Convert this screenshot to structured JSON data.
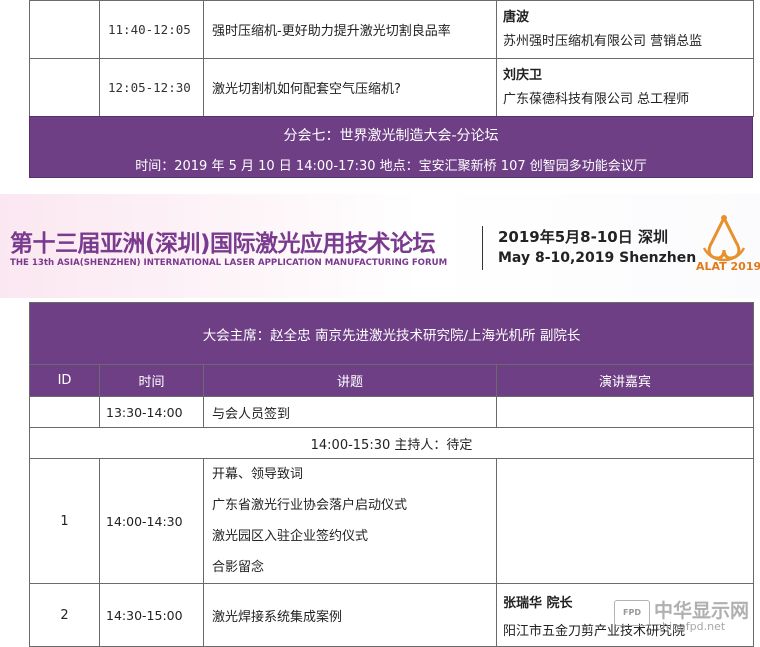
{
  "top_rows": [
    {
      "time": "11:40-12:05",
      "topic": "强时压缩机-更好助力提升激光切割良品率",
      "speaker": "唐波",
      "affiliation": "苏州强时压缩机有限公司  营销总监"
    },
    {
      "time": "12:05-12:30",
      "topic": "激光切割机如何配套空气压缩机?",
      "speaker": "刘庆卫",
      "affiliation": "广东葆德科技有限公司  总工程师"
    }
  ],
  "session7": {
    "title": "分会七：世界激光制造大会-分论坛",
    "info": "时间：2019 年 5 月 10 日  14:00-17:30  地点：宝安汇聚新桥 107 创智园多功能会议厅"
  },
  "banner": {
    "title": "第十三届亚洲(深圳)国际激光应用技术论坛",
    "subtitle": "THE 13th ASIA(SHENZHEN) INTERNATIONAL LASER APPLICATION MANUFACTURING FORUM",
    "date_cn": "2019年5月8-10日   深圳",
    "date_en": "May 8-10,2019   Shenzhen",
    "logo_text": "ALAT 2019",
    "logo_color": "#e8902a"
  },
  "chair": "大会主席：赵全忠    南京先进激光技术研究院/上海光机所  副院长",
  "headers": {
    "id": "ID",
    "time": "时间",
    "topic": "讲题",
    "speaker": "演讲嘉宾"
  },
  "rows": {
    "checkin": {
      "id": "",
      "time": "13:30-14:00",
      "topic": "与会人员签到"
    },
    "section_host": "14:00-15:30  主持人：待定",
    "r1": {
      "id": "1",
      "time": "14:00-14:30",
      "topics": [
        "开幕、领导致词",
        "广东省激光行业协会落户启动仪式",
        "激光园区入驻企业签约仪式",
        "合影留念"
      ]
    },
    "r2": {
      "id": "2",
      "time": "14:30-15:00",
      "topic": "激光焊接系统集成案例",
      "speaker": "张瑞华  院长",
      "affiliation": "阳江市五金刀剪产业技术研究院"
    }
  },
  "watermark": {
    "badge": "FPD",
    "cn": "中华显示网",
    "en": "chinafpd.net"
  },
  "colors": {
    "purple": "#6f3f86",
    "banner_title": "#7a3b8f"
  }
}
